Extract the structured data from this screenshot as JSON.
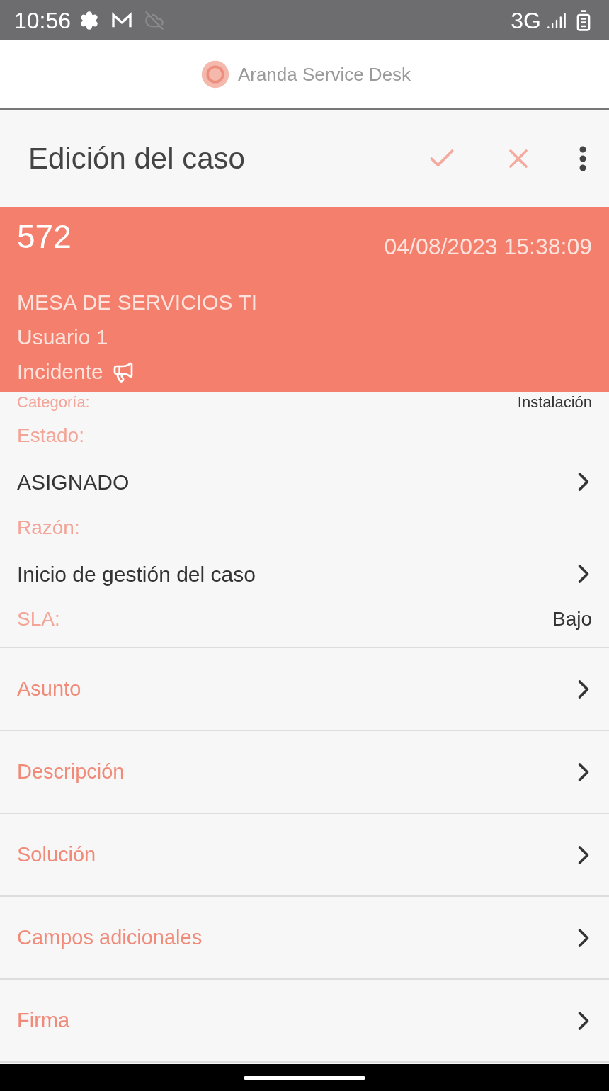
{
  "status_bar": {
    "time": "10:56",
    "network": "3G"
  },
  "app_header": {
    "title": "Aranda Service Desk"
  },
  "toolbar": {
    "title": "Edición del caso"
  },
  "case": {
    "number": "572",
    "date": "04/08/2023 15:38:09",
    "group": "MESA DE SERVICIOS TI",
    "user": "Usuario 1",
    "type": "Incidente"
  },
  "partial_field": {
    "label": "Categoría:",
    "value": "Instalación"
  },
  "fields": [
    {
      "kind": "label",
      "text": "Estado:"
    },
    {
      "kind": "link",
      "text": "ASIGNADO"
    },
    {
      "kind": "label",
      "text": "Razón:"
    },
    {
      "kind": "link",
      "text": "Inicio de gestión del caso"
    },
    {
      "kind": "pair",
      "text": "SLA:",
      "value": "Bajo"
    }
  ],
  "sections": [
    "Asunto",
    "Descripción",
    "Solución",
    "Campos adicionales",
    "Firma"
  ]
}
